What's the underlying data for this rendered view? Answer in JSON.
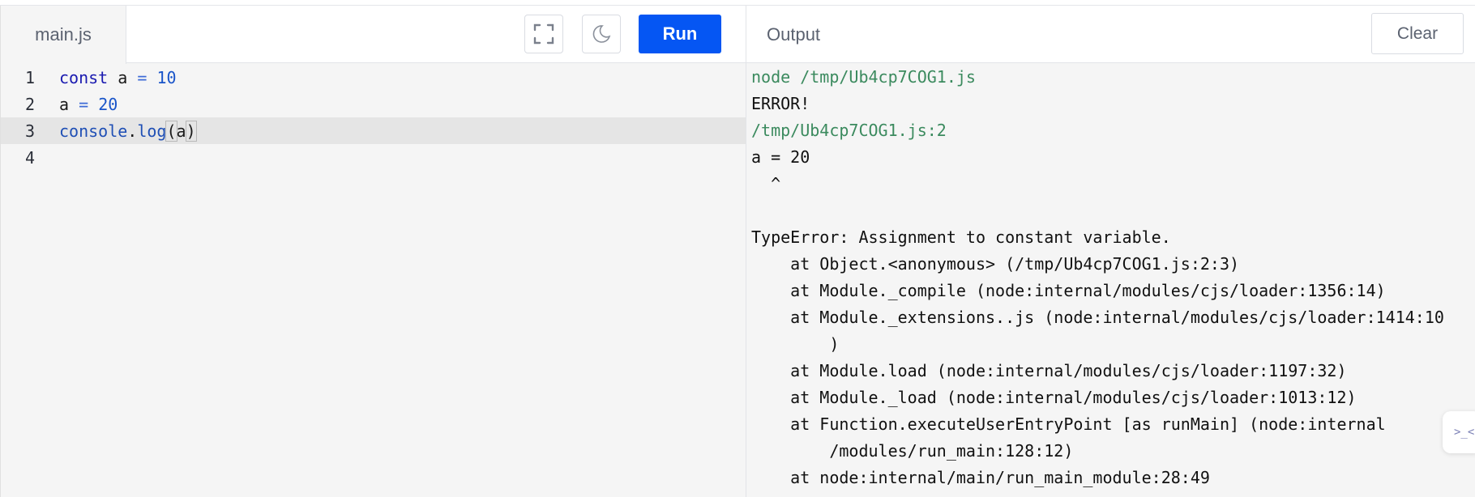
{
  "editor": {
    "file_tab": "main.js",
    "run_label": "Run",
    "fullscreen_icon": "fullscreen-icon",
    "theme_icon": "moon-icon",
    "lines": [
      {
        "num": "1"
      },
      {
        "num": "2"
      },
      {
        "num": "3"
      },
      {
        "num": "4"
      }
    ],
    "code": {
      "l1_kw": "const",
      "l1_var": " a ",
      "l1_op": "=",
      "l1_num": "10",
      "l2_var": "a ",
      "l2_op": "=",
      "l2_num": "20",
      "l3_obj": "console",
      "l3_dot": ".",
      "l3_fn": "log",
      "l3_open": "(",
      "l3_arg": "a",
      "l3_close": ")"
    }
  },
  "output": {
    "title": "Output",
    "clear_label": "Clear",
    "lines": [
      "node /tmp/Ub4cp7COG1.js",
      "ERROR!",
      "/tmp/Ub4cp7COG1.js:2",
      "a = 20",
      "  ^",
      "",
      "TypeError: Assignment to constant variable.",
      "    at Object.<anonymous> (/tmp/Ub4cp7COG1.js:2:3)",
      "    at Module._compile (node:internal/modules/cjs/loader:1356:14)",
      "    at Module._extensions..js (node:internal/modules/cjs/loader:1414:10",
      "        )",
      "    at Module.load (node:internal/modules/cjs/loader:1197:32)",
      "    at Module._load (node:internal/modules/cjs/loader:1013:12)",
      "    at Function.executeUserEntryPoint [as runMain] (node:internal",
      "        /modules/run_main:128:12)",
      "    at node:internal/main/run_main_module:28:49"
    ]
  },
  "badge": {
    "text": ">_<"
  },
  "colors": {
    "accent": "#0556f3",
    "output_path": "#3b8a5e",
    "editor_bg": "#f5f5f5",
    "active_line": "#e5e5e5"
  }
}
